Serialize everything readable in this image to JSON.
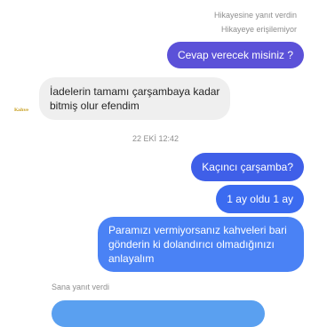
{
  "story_reply_top": {
    "title": "Hikayesine yanıt verdin",
    "subtitle": "Hikayeye erişilemiyor"
  },
  "avatar": {
    "icon": "brand-logo-icon",
    "logo_text": "Kahve"
  },
  "timestamp": "22 EKİ 12:42",
  "messages": [
    {
      "direction": "out",
      "lines": [
        "Cevap verecek misiniz ?"
      ]
    },
    {
      "direction": "in",
      "lines": [
        "İadelerin tamamı  çarşambaya kadar",
        "bitmiş olur efendim"
      ]
    },
    {
      "direction": "out",
      "lines": [
        "Kaçıncı çarşamba?"
      ]
    },
    {
      "direction": "out",
      "lines": [
        "1 ay oldu 1 ay"
      ]
    },
    {
      "direction": "out",
      "lines": [
        "Paramızı vermiyorsanız kahveleri bari",
        "gönderin ki dolandırıcı olmadığınızı",
        "anlayalım"
      ]
    }
  ],
  "story_reply_bottom": {
    "title": "Sana yanıt verdi"
  },
  "colors": {
    "bubble_out_purple": "#5b51d8",
    "bubble_out_blue": "#3f5fe8",
    "bubble_out_blue2": "#3b6bf0",
    "bubble_out_bottom": "#4a82f5",
    "bubble_in": "#efefef",
    "meta_text": "#8e8e8e"
  }
}
